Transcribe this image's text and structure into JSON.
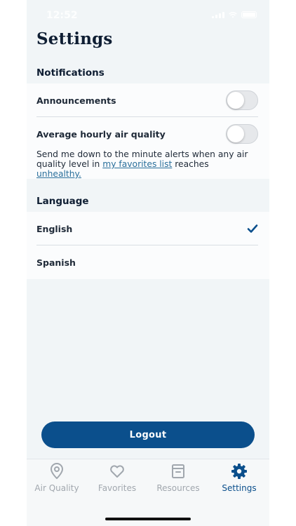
{
  "status_bar": {
    "time": "12:52"
  },
  "header": {
    "title": "Settings"
  },
  "notifications": {
    "section_title": "Notifications",
    "items": [
      {
        "label": "Announcements",
        "enabled": false
      },
      {
        "label": "Average hourly air quality",
        "enabled": false
      }
    ],
    "description": {
      "part1": "Send me down to the minute alerts when any air quality level in ",
      "link1": "my favorites list",
      "part2": " reaches ",
      "link2": "unhealthy."
    }
  },
  "language": {
    "section_title": "Language",
    "options": [
      {
        "label": "English",
        "selected": true
      },
      {
        "label": "Spanish",
        "selected": false
      }
    ]
  },
  "logout_label": "Logout",
  "tabbar": {
    "tabs": [
      {
        "label": "Air Quality",
        "icon": "location-pin-icon",
        "active": false
      },
      {
        "label": "Favorites",
        "icon": "heart-icon",
        "active": false
      },
      {
        "label": "Resources",
        "icon": "archive-box-icon",
        "active": false
      },
      {
        "label": "Settings",
        "icon": "gear-icon",
        "active": true
      }
    ]
  },
  "colors": {
    "accent": "#0b4f8c",
    "link": "#2a6f9b",
    "background": "#f1f5f7",
    "inactive_tab": "#a1a7ae"
  }
}
